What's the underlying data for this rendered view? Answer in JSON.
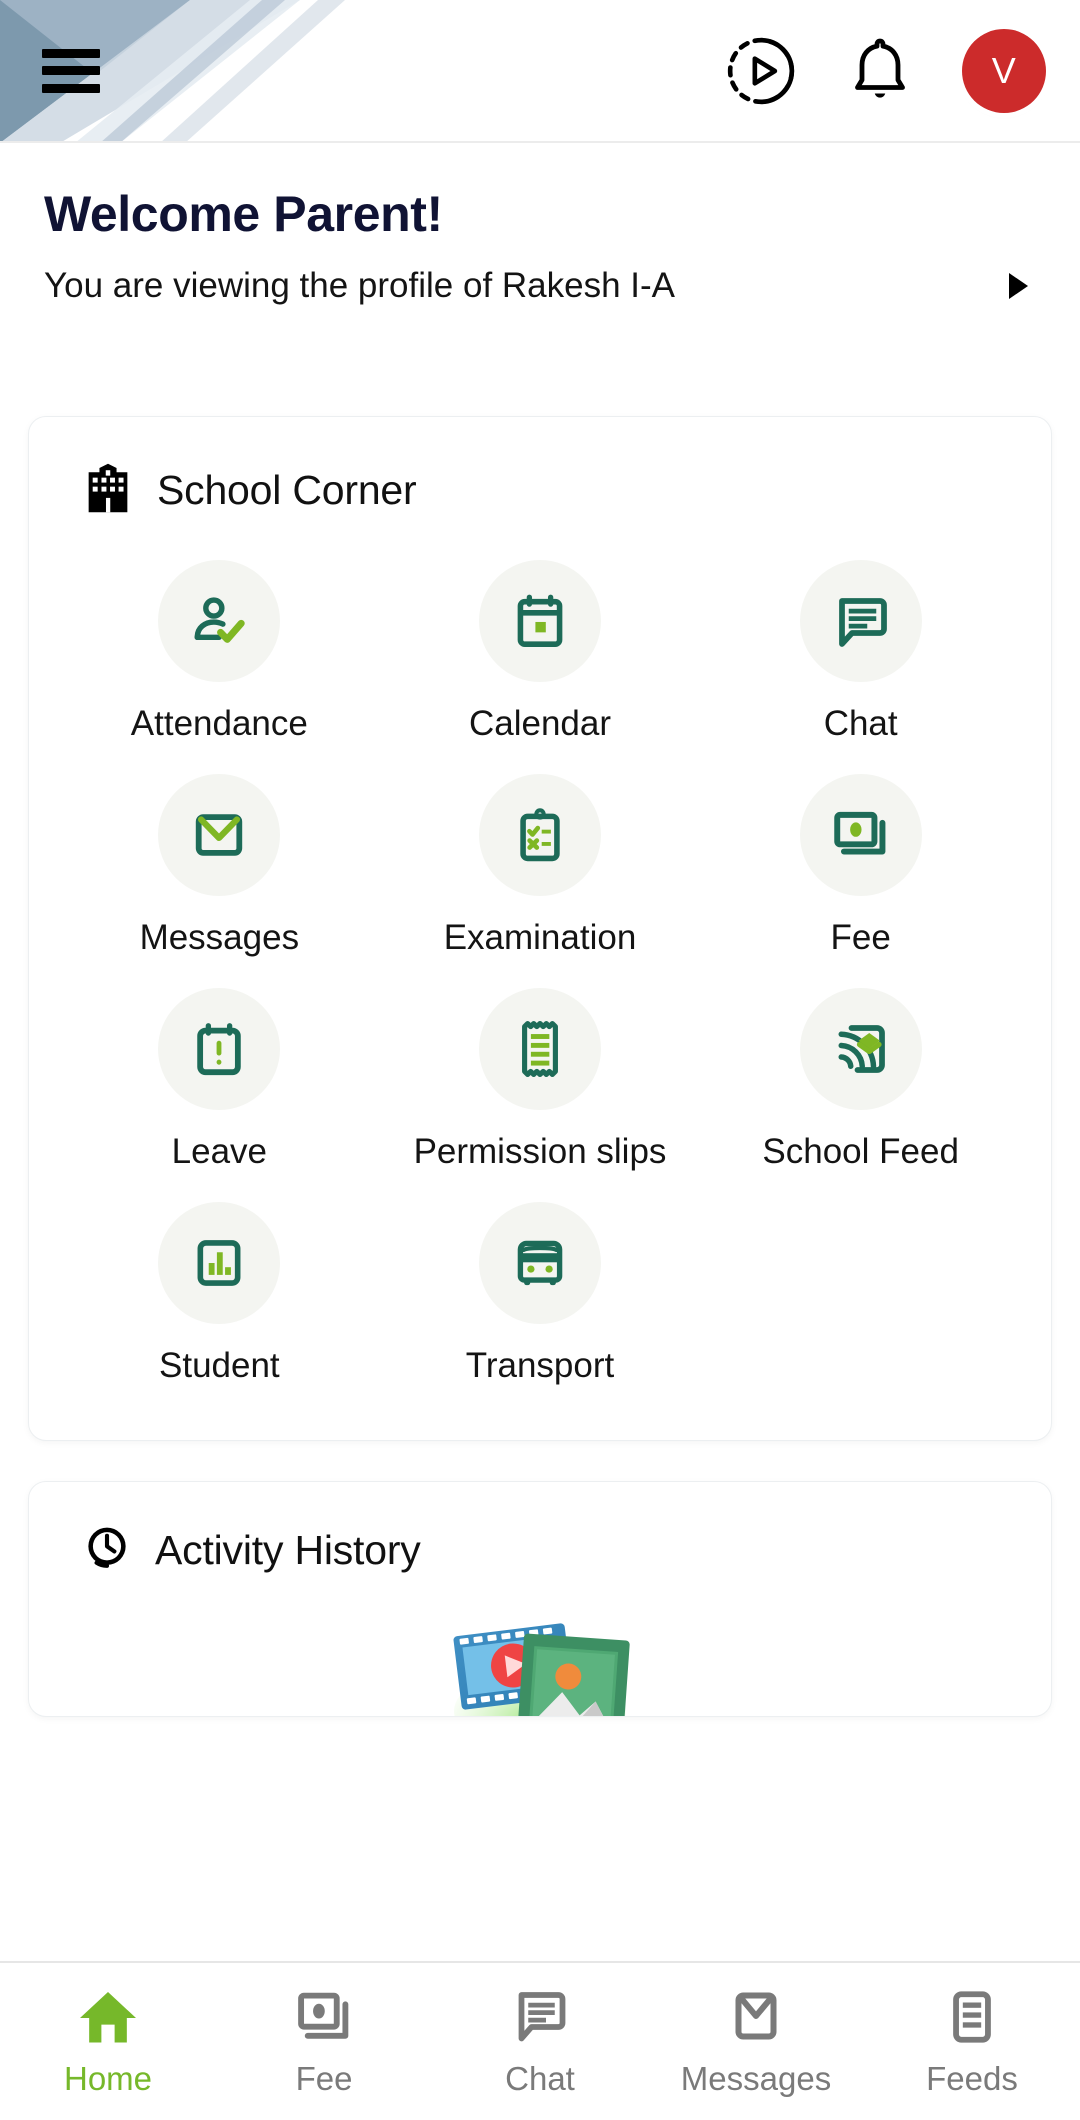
{
  "colors": {
    "accent_green": "#76b82a",
    "icon_dark_green": "#1d6b58",
    "avatar_red": "#cc2b2b",
    "title_navy": "#101334",
    "bubble_bg": "#f4f5f1"
  },
  "header": {
    "menu_icon": "hamburger-menu-icon",
    "tour_icon": "play-circle-dashed-icon",
    "notification_icon": "bell-icon",
    "avatar_initial": "V"
  },
  "welcome": {
    "title": "Welcome Parent!",
    "profile_text": "You are viewing the profile of Rakesh I-A",
    "caret_icon": "chevron-right-icon"
  },
  "school_corner": {
    "title": "School Corner",
    "icon": "school-building-icon",
    "items": [
      {
        "label": "Attendance",
        "icon": "person-check-icon"
      },
      {
        "label": "Calendar",
        "icon": "calendar-icon"
      },
      {
        "label": "Chat",
        "icon": "chat-bubble-icon"
      },
      {
        "label": "Messages",
        "icon": "envelope-icon"
      },
      {
        "label": "Examination",
        "icon": "clipboard-check-icon"
      },
      {
        "label": "Fee",
        "icon": "cards-stack-icon"
      },
      {
        "label": "Leave",
        "icon": "calendar-alert-icon"
      },
      {
        "label": "Permission slips",
        "icon": "receipt-icon"
      },
      {
        "label": "School Feed",
        "icon": "feed-broadcast-icon"
      },
      {
        "label": "Student",
        "icon": "bar-chart-icon"
      },
      {
        "label": "Transport",
        "icon": "bus-icon"
      }
    ]
  },
  "activity_history": {
    "title": "Activity History",
    "icon": "clock-icon",
    "art": "media-photo-video-illustration"
  },
  "bottom_nav": {
    "items": [
      {
        "label": "Home",
        "icon": "home-icon",
        "active": true
      },
      {
        "label": "Fee",
        "icon": "cards-stack-icon",
        "active": false
      },
      {
        "label": "Chat",
        "icon": "chat-bubble-icon",
        "active": false
      },
      {
        "label": "Messages",
        "icon": "envelope-icon",
        "active": false
      },
      {
        "label": "Feeds",
        "icon": "feed-list-icon",
        "active": false
      }
    ]
  }
}
